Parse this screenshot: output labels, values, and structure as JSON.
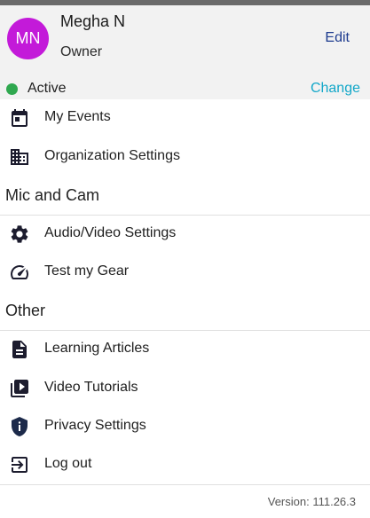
{
  "profile": {
    "initials": "MN",
    "name": "Megha N",
    "role": "Owner",
    "edit_label": "Edit",
    "avatar_color": "#c31ad9"
  },
  "status": {
    "text": "Active",
    "change_label": "Change",
    "dot_color": "#2fa84f"
  },
  "menu": [
    {
      "label": "My Events",
      "icon": "calendar-icon"
    },
    {
      "label": "Organization Settings",
      "icon": "building-icon"
    }
  ],
  "sections": [
    {
      "title": "Mic and Cam",
      "items": [
        {
          "label": "Audio/Video Settings",
          "icon": "gear-icon"
        },
        {
          "label": "Test my Gear",
          "icon": "speedometer-icon"
        }
      ]
    },
    {
      "title": "Other",
      "items": [
        {
          "label": "Learning Articles",
          "icon": "document-icon"
        },
        {
          "label": "Video Tutorials",
          "icon": "video-library-icon"
        },
        {
          "label": "Privacy Settings",
          "icon": "shield-info-icon"
        },
        {
          "label": "Log out",
          "icon": "logout-icon"
        }
      ]
    }
  ],
  "footer": {
    "version": "Version: 111.26.3"
  },
  "colors": {
    "header_bg": "#f2f2f2",
    "edit_link": "#1d3b8f",
    "change_link": "#14a8c9",
    "icon_fill": "#1c1c2e"
  }
}
